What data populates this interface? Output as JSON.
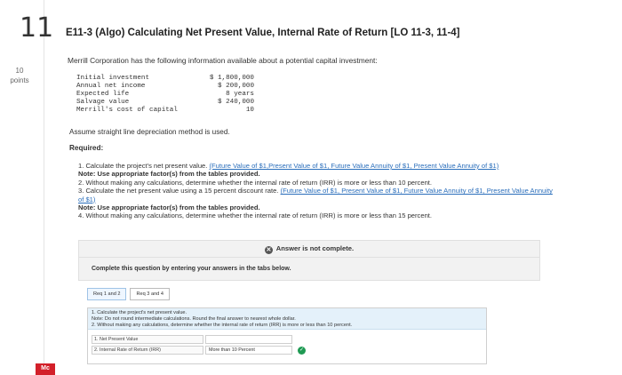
{
  "question": {
    "number": "11",
    "points_value": "10",
    "points_label": "points",
    "title": "E11-3 (Algo) Calculating Net Present Value, Internal Rate of Return [LO 11-3, 11-4]",
    "intro": "Merrill Corporation has the following information available about a potential capital investment:"
  },
  "investment_data": [
    {
      "label": "Initial investment",
      "value": "$ 1,800,000"
    },
    {
      "label": "Annual net income",
      "value": "$ 200,000"
    },
    {
      "label": "Expected life",
      "value": "8 years"
    },
    {
      "label": "Salvage value",
      "value": "$ 240,000"
    },
    {
      "label": "Merrill's cost of capital",
      "value": "10"
    }
  ],
  "assumption": "Assume straight line depreciation method is used.",
  "required_label": "Required:",
  "requirements": {
    "r1_text": "1. Calculate the project's net present value. ",
    "r1_links": "(Future Value of $1,Present Value of $1, Future Value Annuity of $1, Present Value Annuity of $1)",
    "r1_note": "Note: Use appropriate factor(s) from the tables provided.",
    "r2_text": "2. Without making any calculations, determine whether the internal rate of return (IRR) is more or less than 10 percent.",
    "r3_text": "3. Calculate the net present value using a 15 percent discount rate. ",
    "r3_links": "(Future Value of $1, Present Value of $1, Future Value Annuity of $1, Present Value Annuity of $1)",
    "r3_note": "Note: Use appropriate factor(s) from the tables provided.",
    "r4_text": "4. Without making any calculations, determine whether the internal rate of return (IRR) is more or less than 15 percent."
  },
  "status": {
    "icon": "x-circle-icon",
    "text": "Answer is not complete.",
    "message": "Complete this question by entering your answers in the tabs below."
  },
  "tabs": [
    {
      "label": "Req 1 and 2"
    },
    {
      "label": "Req 3 and 4"
    }
  ],
  "instructions": {
    "line1": "1. Calculate the project's net present value.",
    "line2": "Note: Do not round intermediate calculations. Round the final answer to nearest whole dollar.",
    "line3": "2. Without making any calculations, determine whether the internal rate of return (IRR) is more or less than 10 percent."
  },
  "answer_rows": [
    {
      "label": "1. Net Present Value",
      "value": ""
    },
    {
      "label": "2. Internal Rate of Return (IRR)",
      "value": "More than 10 Percent"
    }
  ],
  "logo_text": "Mc",
  "colors": {
    "link": "#2a6ebb",
    "success": "#1f9a53",
    "logo": "#d3202a",
    "instr_bg": "#e4f1fa"
  }
}
